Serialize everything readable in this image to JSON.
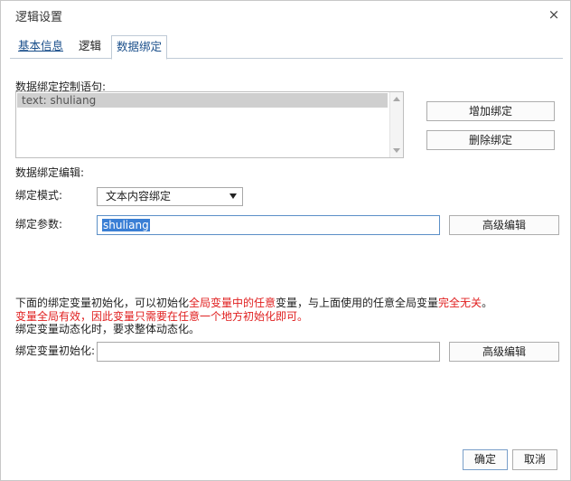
{
  "window": {
    "title": "逻辑设置",
    "close_glyph": "×"
  },
  "tabs": [
    {
      "label": "基本信息"
    },
    {
      "label": "逻辑"
    },
    {
      "label": "数据绑定",
      "active": true
    }
  ],
  "binding_list": {
    "label": "数据绑定控制语句:",
    "items": [
      "text: shuliang"
    ],
    "add_button": "增加绑定",
    "delete_button": "删除绑定"
  },
  "editor": {
    "section_label": "数据绑定编辑:",
    "mode_label": "绑定模式:",
    "mode_value": "文本内容绑定",
    "param_label": "绑定参数:",
    "param_value": "shuliang",
    "advanced_button": "高级编辑"
  },
  "notes": {
    "line1_part1": "下面的绑定变量初始化，可以初始化",
    "line1_part2": "全局变量中的任意",
    "line1_part3": "变量，与上面使用的任意全局变量",
    "line1_part4": "完全无关",
    "line1_part5": "。",
    "line2": "变量全局有效，因此变量只需要在任意一个地方初始化即可。",
    "line3": "绑定变量动态化时，要求整体动态化。"
  },
  "init": {
    "label": "绑定变量初始化:",
    "value": "",
    "advanced_button": "高级编辑"
  },
  "footer": {
    "ok": "确定",
    "cancel": "取消"
  },
  "colors": {
    "accent": "#1a4f8b",
    "warning": "#e02020",
    "selection": "#3a7fd5"
  }
}
